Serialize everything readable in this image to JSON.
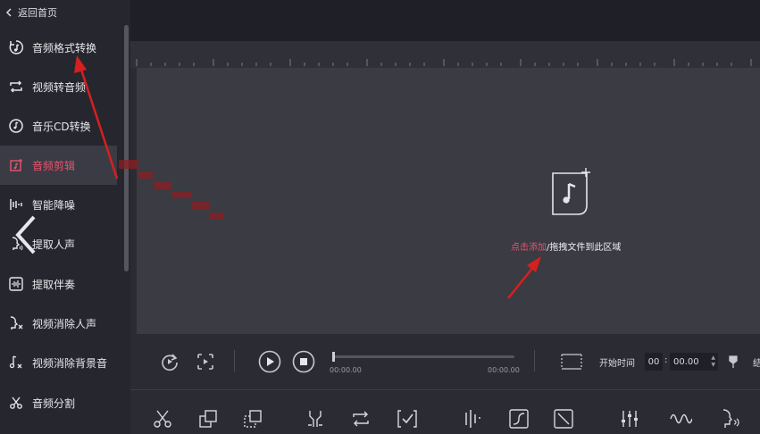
{
  "sidebar": {
    "back_label": "返回首页",
    "items": [
      {
        "label": "音频格式转换",
        "icon": "audio-convert-icon"
      },
      {
        "label": "视频转音频",
        "icon": "video-to-audio-icon"
      },
      {
        "label": "音乐CD转换",
        "icon": "cd-icon"
      },
      {
        "label": "音频剪辑",
        "icon": "audio-edit-icon",
        "active": true
      },
      {
        "label": "智能降噪",
        "icon": "denoise-icon"
      },
      {
        "label": "提取人声",
        "icon": "voice-extract-icon"
      },
      {
        "label": "提取伴奏",
        "icon": "accompaniment-icon"
      },
      {
        "label": "视频消除人声",
        "icon": "video-remove-voice-icon"
      },
      {
        "label": "视频消除背景音",
        "icon": "video-remove-bg-icon"
      },
      {
        "label": "音频分割",
        "icon": "scissors-icon"
      }
    ]
  },
  "dropzone": {
    "link_text": "点击添加",
    "rest_text": "/拖拽文件到此区域"
  },
  "player": {
    "current_time": "00:00.00",
    "total_time": "00:00.00",
    "progress": 0,
    "start_label": "开始时间",
    "start_hour": "00",
    "start_sep": ":",
    "start_min": "00.00",
    "end_label_partial": "结"
  },
  "colors": {
    "accent": "#e8546e",
    "sidebar_bg": "#26272e",
    "drop_bg": "#3a3b43"
  }
}
